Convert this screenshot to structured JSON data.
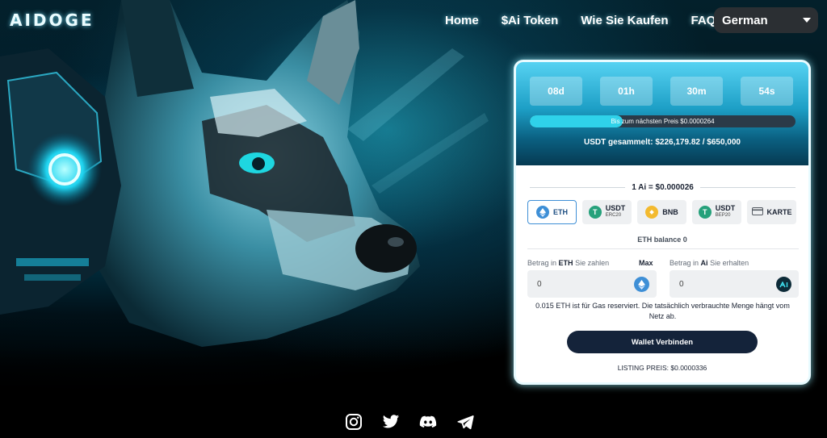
{
  "header": {
    "logo_text": "AIDOGE",
    "nav": [
      "Home",
      "$Ai Token",
      "Wie Sie Kaufen",
      "FAQ"
    ],
    "language": "German"
  },
  "widget": {
    "timer": [
      "08d",
      "01h",
      "30m",
      "54s"
    ],
    "progress_fraction": 0.35,
    "progress_text": "Bis zum nächsten Preis $0.0000264",
    "raised_text": "USDT gesammelt: $226,179.82 / $650,000",
    "rate_text": "1 Ai = $0.000026",
    "payment_options": [
      {
        "label": "ETH",
        "sub": "",
        "icon": "eth-icon",
        "color": "#3e8fd6",
        "active": true
      },
      {
        "label": "USDT",
        "sub": "ERC20",
        "icon": "usdt-icon",
        "color": "#26a17b",
        "active": false
      },
      {
        "label": "BNB",
        "sub": "",
        "icon": "bnb-icon",
        "color": "#f3ba2f",
        "active": false
      },
      {
        "label": "USDT",
        "sub": "BEP20",
        "icon": "usdt-icon",
        "color": "#26a17b",
        "active": false
      },
      {
        "label": "KARTE",
        "sub": "",
        "icon": "card-icon",
        "color": "#555b63",
        "active": false
      }
    ],
    "balance_text": "ETH balance 0",
    "pay_label_prefix": "Betrag in",
    "pay_label_token": "ETH",
    "pay_label_suffix": "Sie zahlen",
    "max_label": "Max",
    "receive_label_prefix": "Betrag in",
    "receive_label_token": "Ai",
    "receive_label_suffix": "Sie erhalten",
    "pay_value": "0",
    "receive_value": "0",
    "gas_note": "0.015 ETH ist für Gas reserviert. Die tatsächlich verbrauchte Menge hängt vom Netz ab.",
    "connect_label": "Wallet Verbinden",
    "listing_text": "LISTING PREIS: $0.0000336"
  },
  "socials": [
    "instagram-icon",
    "twitter-icon",
    "discord-icon",
    "telegram-icon"
  ]
}
